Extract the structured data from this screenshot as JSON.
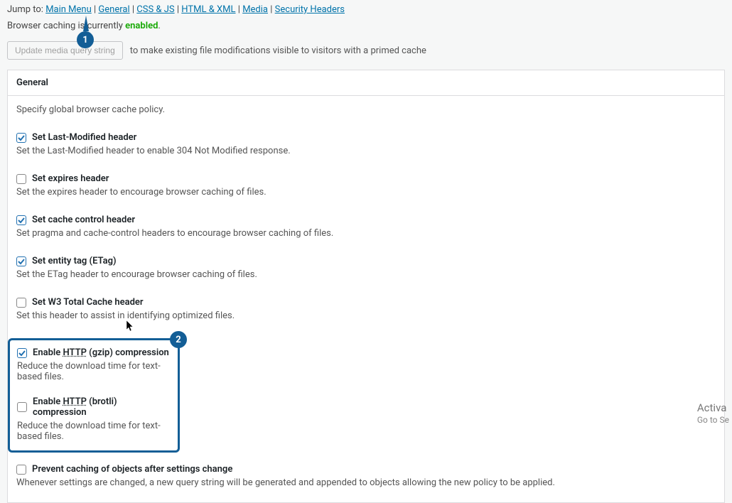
{
  "nav": {
    "prefix": "Jump to:",
    "links": [
      "Main Menu",
      "General",
      "CSS & JS",
      "HTML & XML",
      "Media",
      "Security Headers"
    ]
  },
  "status": {
    "prefix": "Browser caching is currently",
    "value": "enabled",
    "suffix": "."
  },
  "update": {
    "button": "Update media query string",
    "hint": "to make existing file modifications visible to visitors with a primed cache"
  },
  "panel": {
    "title": "General",
    "policy": "Specify global browser cache policy."
  },
  "opts": {
    "lastmod": {
      "label": "Set Last-Modified header",
      "desc": "Set the Last-Modified header to enable 304 Not Modified response."
    },
    "expires": {
      "label": "Set expires header",
      "desc": "Set the expires header to encourage browser caching of files."
    },
    "cachectrl": {
      "label": "Set cache control header",
      "desc": "Set pragma and cache-control headers to encourage browser caching of files."
    },
    "etag": {
      "label": "Set entity tag (ETag)",
      "desc": "Set the ETag header to encourage browser caching of files."
    },
    "w3tc": {
      "label": "Set W3 Total Cache header",
      "desc": "Set this header to assist in identifying optimized files."
    },
    "gzip": {
      "label_pre": "Enable ",
      "http": "HTTP",
      "label_post": " (gzip) compression",
      "desc": "Reduce the download time for text-based files."
    },
    "brotli": {
      "label_pre": "Enable ",
      "http": "HTTP",
      "label_post": " (brotli) compression",
      "desc": "Reduce the download time for text-based files."
    },
    "prevent": {
      "label": "Prevent caching of objects after settings change",
      "desc": "Whenever settings are changed, a new query string will be generated and appended to objects allowing the new policy to be applied."
    }
  },
  "markers": {
    "m1": "1",
    "m2": "2"
  },
  "watermark": {
    "l1": "Activa",
    "l2": "Go to Se"
  }
}
